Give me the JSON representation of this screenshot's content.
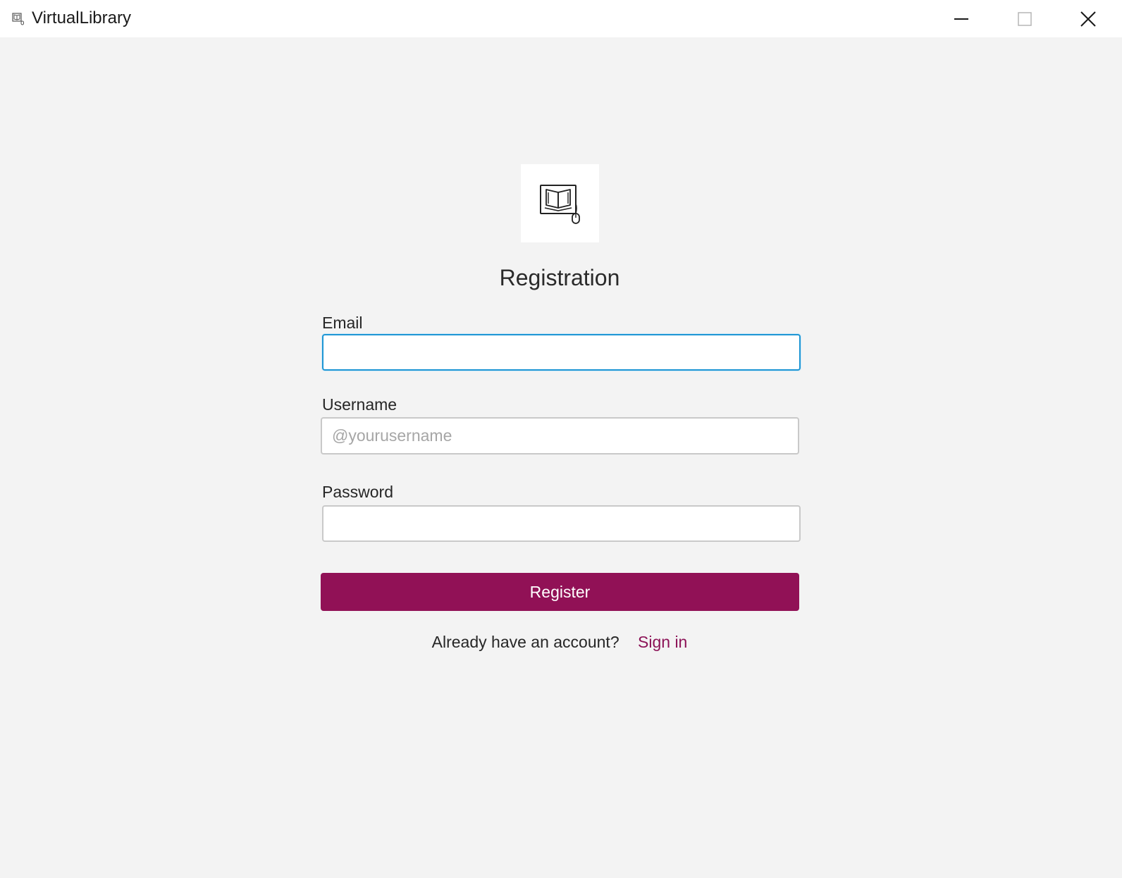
{
  "window": {
    "title": "VirtualLibrary",
    "icon": "book-mouse-icon",
    "controls": [
      "minimize-icon",
      "maximize-icon",
      "close-icon"
    ]
  },
  "logo": {
    "icon": "book-mouse-icon"
  },
  "form": {
    "title": "Registration",
    "email": {
      "label": "Email",
      "value": "",
      "placeholder": ""
    },
    "username": {
      "label": "Username",
      "value": "",
      "placeholder": "@yourusername"
    },
    "password": {
      "label": "Password",
      "value": "",
      "placeholder": ""
    },
    "register_label": "Register",
    "signin_prompt": "Already have an account?",
    "signin_link": "Sign in"
  },
  "colors": {
    "accent": "#911156",
    "link": "#8c1357",
    "focus_border": "#1e96d4",
    "background": "#f3f3f3"
  }
}
